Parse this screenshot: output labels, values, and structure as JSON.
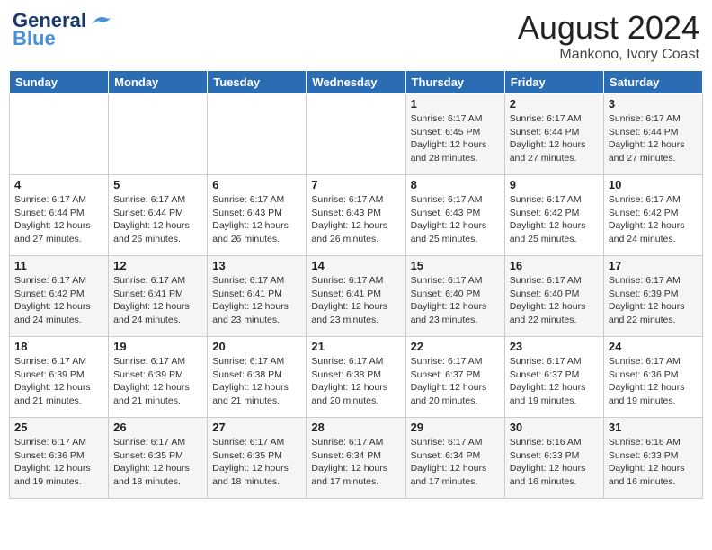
{
  "header": {
    "logo_line1": "General",
    "logo_line2": "Blue",
    "month": "August 2024",
    "location": "Mankono, Ivory Coast"
  },
  "weekdays": [
    "Sunday",
    "Monday",
    "Tuesday",
    "Wednesday",
    "Thursday",
    "Friday",
    "Saturday"
  ],
  "weeks": [
    [
      {
        "day": "",
        "info": ""
      },
      {
        "day": "",
        "info": ""
      },
      {
        "day": "",
        "info": ""
      },
      {
        "day": "",
        "info": ""
      },
      {
        "day": "1",
        "info": "Sunrise: 6:17 AM\nSunset: 6:45 PM\nDaylight: 12 hours\nand 28 minutes."
      },
      {
        "day": "2",
        "info": "Sunrise: 6:17 AM\nSunset: 6:44 PM\nDaylight: 12 hours\nand 27 minutes."
      },
      {
        "day": "3",
        "info": "Sunrise: 6:17 AM\nSunset: 6:44 PM\nDaylight: 12 hours\nand 27 minutes."
      }
    ],
    [
      {
        "day": "4",
        "info": "Sunrise: 6:17 AM\nSunset: 6:44 PM\nDaylight: 12 hours\nand 27 minutes."
      },
      {
        "day": "5",
        "info": "Sunrise: 6:17 AM\nSunset: 6:44 PM\nDaylight: 12 hours\nand 26 minutes."
      },
      {
        "day": "6",
        "info": "Sunrise: 6:17 AM\nSunset: 6:43 PM\nDaylight: 12 hours\nand 26 minutes."
      },
      {
        "day": "7",
        "info": "Sunrise: 6:17 AM\nSunset: 6:43 PM\nDaylight: 12 hours\nand 26 minutes."
      },
      {
        "day": "8",
        "info": "Sunrise: 6:17 AM\nSunset: 6:43 PM\nDaylight: 12 hours\nand 25 minutes."
      },
      {
        "day": "9",
        "info": "Sunrise: 6:17 AM\nSunset: 6:42 PM\nDaylight: 12 hours\nand 25 minutes."
      },
      {
        "day": "10",
        "info": "Sunrise: 6:17 AM\nSunset: 6:42 PM\nDaylight: 12 hours\nand 24 minutes."
      }
    ],
    [
      {
        "day": "11",
        "info": "Sunrise: 6:17 AM\nSunset: 6:42 PM\nDaylight: 12 hours\nand 24 minutes."
      },
      {
        "day": "12",
        "info": "Sunrise: 6:17 AM\nSunset: 6:41 PM\nDaylight: 12 hours\nand 24 minutes."
      },
      {
        "day": "13",
        "info": "Sunrise: 6:17 AM\nSunset: 6:41 PM\nDaylight: 12 hours\nand 23 minutes."
      },
      {
        "day": "14",
        "info": "Sunrise: 6:17 AM\nSunset: 6:41 PM\nDaylight: 12 hours\nand 23 minutes."
      },
      {
        "day": "15",
        "info": "Sunrise: 6:17 AM\nSunset: 6:40 PM\nDaylight: 12 hours\nand 23 minutes."
      },
      {
        "day": "16",
        "info": "Sunrise: 6:17 AM\nSunset: 6:40 PM\nDaylight: 12 hours\nand 22 minutes."
      },
      {
        "day": "17",
        "info": "Sunrise: 6:17 AM\nSunset: 6:39 PM\nDaylight: 12 hours\nand 22 minutes."
      }
    ],
    [
      {
        "day": "18",
        "info": "Sunrise: 6:17 AM\nSunset: 6:39 PM\nDaylight: 12 hours\nand 21 minutes."
      },
      {
        "day": "19",
        "info": "Sunrise: 6:17 AM\nSunset: 6:39 PM\nDaylight: 12 hours\nand 21 minutes."
      },
      {
        "day": "20",
        "info": "Sunrise: 6:17 AM\nSunset: 6:38 PM\nDaylight: 12 hours\nand 21 minutes."
      },
      {
        "day": "21",
        "info": "Sunrise: 6:17 AM\nSunset: 6:38 PM\nDaylight: 12 hours\nand 20 minutes."
      },
      {
        "day": "22",
        "info": "Sunrise: 6:17 AM\nSunset: 6:37 PM\nDaylight: 12 hours\nand 20 minutes."
      },
      {
        "day": "23",
        "info": "Sunrise: 6:17 AM\nSunset: 6:37 PM\nDaylight: 12 hours\nand 19 minutes."
      },
      {
        "day": "24",
        "info": "Sunrise: 6:17 AM\nSunset: 6:36 PM\nDaylight: 12 hours\nand 19 minutes."
      }
    ],
    [
      {
        "day": "25",
        "info": "Sunrise: 6:17 AM\nSunset: 6:36 PM\nDaylight: 12 hours\nand 19 minutes."
      },
      {
        "day": "26",
        "info": "Sunrise: 6:17 AM\nSunset: 6:35 PM\nDaylight: 12 hours\nand 18 minutes."
      },
      {
        "day": "27",
        "info": "Sunrise: 6:17 AM\nSunset: 6:35 PM\nDaylight: 12 hours\nand 18 minutes."
      },
      {
        "day": "28",
        "info": "Sunrise: 6:17 AM\nSunset: 6:34 PM\nDaylight: 12 hours\nand 17 minutes."
      },
      {
        "day": "29",
        "info": "Sunrise: 6:17 AM\nSunset: 6:34 PM\nDaylight: 12 hours\nand 17 minutes."
      },
      {
        "day": "30",
        "info": "Sunrise: 6:16 AM\nSunset: 6:33 PM\nDaylight: 12 hours\nand 16 minutes."
      },
      {
        "day": "31",
        "info": "Sunrise: 6:16 AM\nSunset: 6:33 PM\nDaylight: 12 hours\nand 16 minutes."
      }
    ]
  ]
}
